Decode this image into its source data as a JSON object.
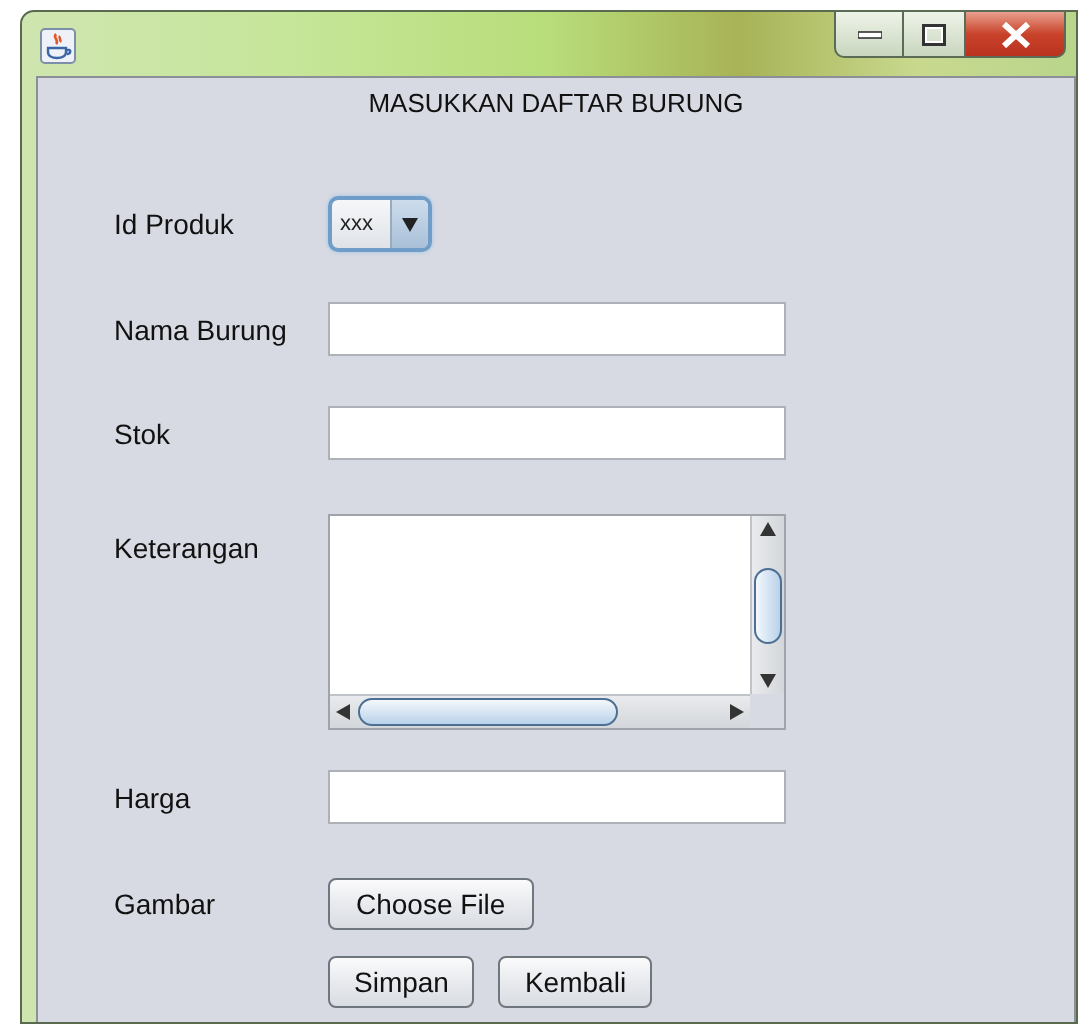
{
  "form": {
    "title": "MASUKKAN DAFTAR BURUNG",
    "fields": [
      {
        "kind": "combo",
        "label": "Id Produk",
        "value": "xxx"
      },
      {
        "kind": "text",
        "label": "Nama Burung"
      },
      {
        "kind": "text",
        "label": "Stok"
      },
      {
        "kind": "textarea",
        "label": "Keterangan"
      },
      {
        "kind": "text",
        "label": "Harga"
      },
      {
        "kind": "file",
        "label": "Gambar",
        "button": "Choose File"
      }
    ],
    "buttons": [
      "Simpan",
      "Kembali"
    ]
  }
}
